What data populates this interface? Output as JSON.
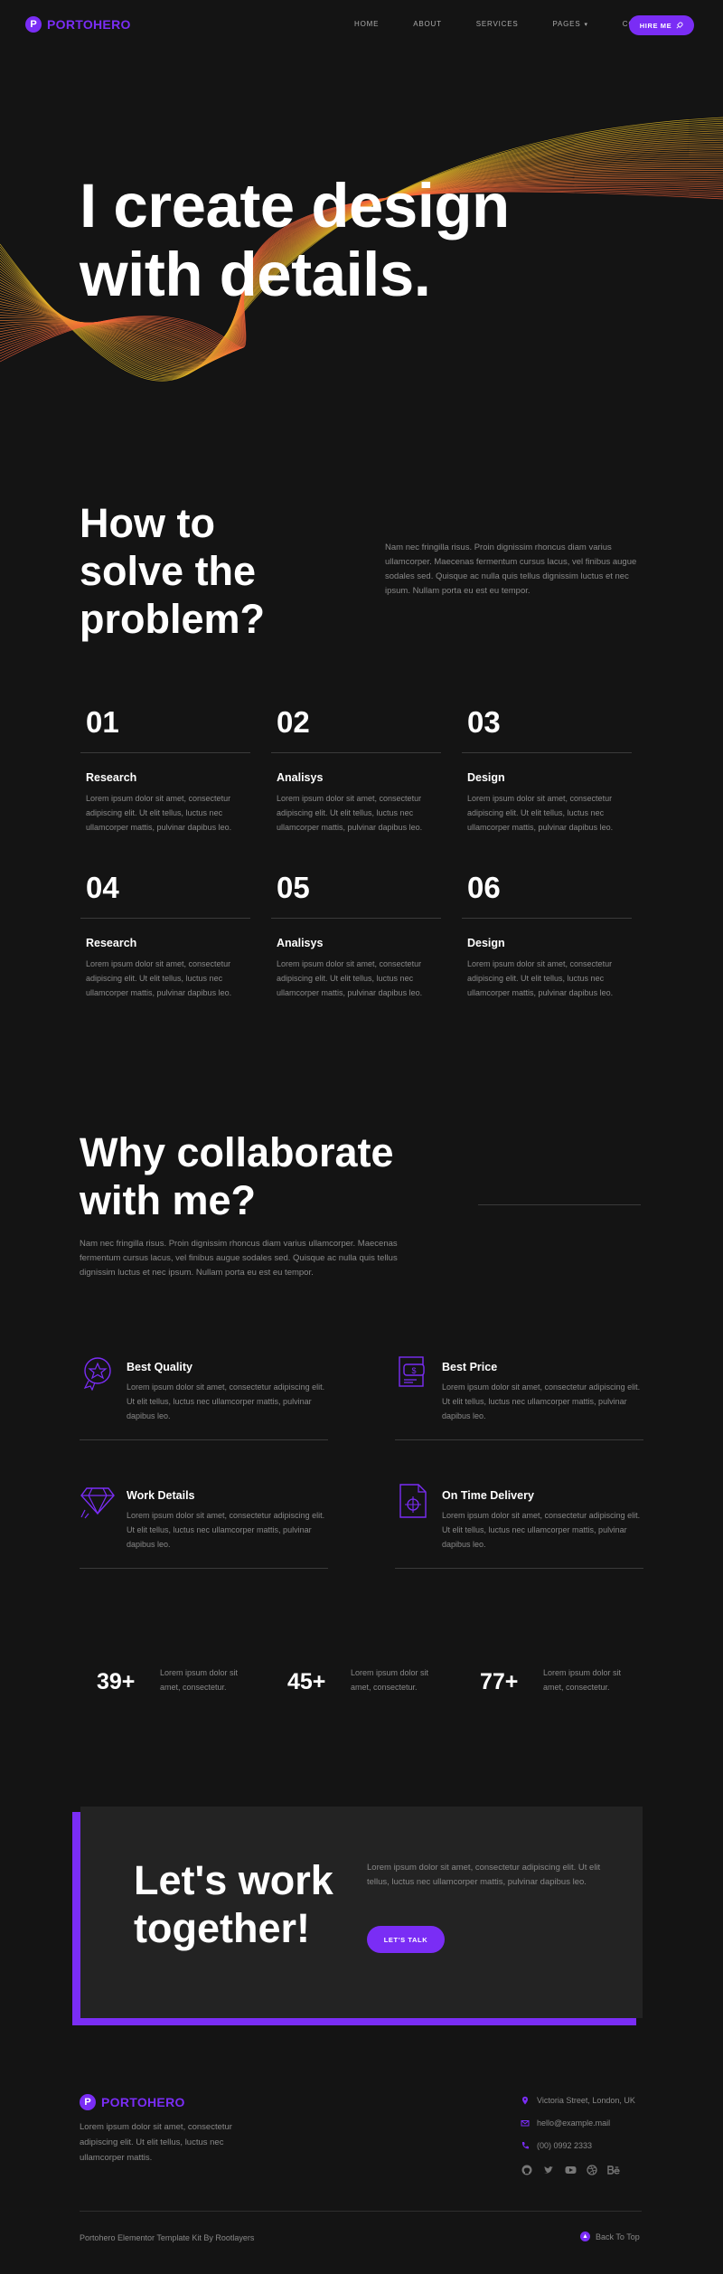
{
  "brand": {
    "logo_letter": "P",
    "name": "PORTOHERO",
    "accent": "#7a2df5"
  },
  "nav": {
    "items": [
      "HOME",
      "ABOUT",
      "SERVICES",
      "PAGES",
      "CONTACT"
    ],
    "pages_chevron": "chevron-down-icon",
    "hire_label": "HIRE ME",
    "hire_icon": "rocket-icon"
  },
  "hero": {
    "line1": "I create design",
    "line2": "with details."
  },
  "problem": {
    "title_lines": [
      "How to",
      "solve the",
      "problem?"
    ],
    "description": "Nam nec fringilla risus. Proin dignissim rhoncus diam varius ullamcorper. Maecenas fermentum cursus lacus, vel finibus augue sodales sed. Quisque ac nulla quis tellus dignissim luctus et nec ipsum. Nullam porta eu est eu tempor.",
    "steps": [
      {
        "num": "01",
        "title": "Research",
        "text": "Lorem ipsum dolor sit amet, consectetur adipiscing elit. Ut elit tellus, luctus nec ullamcorper mattis, pulvinar dapibus leo."
      },
      {
        "num": "02",
        "title": "Analisys",
        "text": "Lorem ipsum dolor sit amet, consectetur adipiscing elit. Ut elit tellus, luctus nec ullamcorper mattis, pulvinar dapibus leo."
      },
      {
        "num": "03",
        "title": "Design",
        "text": "Lorem ipsum dolor sit amet, consectetur adipiscing elit. Ut elit tellus, luctus nec ullamcorper mattis, pulvinar dapibus leo."
      },
      {
        "num": "04",
        "title": "Research",
        "text": "Lorem ipsum dolor sit amet, consectetur adipiscing elit. Ut elit tellus, luctus nec ullamcorper mattis, pulvinar dapibus leo."
      },
      {
        "num": "05",
        "title": "Analisys",
        "text": "Lorem ipsum dolor sit amet, consectetur adipiscing elit. Ut elit tellus, luctus nec ullamcorper mattis, pulvinar dapibus leo."
      },
      {
        "num": "06",
        "title": "Design",
        "text": "Lorem ipsum dolor sit amet, consectetur adipiscing elit. Ut elit tellus, luctus nec ullamcorper mattis, pulvinar dapibus leo."
      }
    ]
  },
  "collab": {
    "title_lines": [
      "Why collaborate",
      "with me?"
    ],
    "description": "Nam nec fringilla risus. Proin dignissim rhoncus diam varius ullamcorper. Maecenas fermentum cursus lacus, vel finibus augue sodales sed. Quisque ac nulla quis tellus dignissim luctus et nec ipsum. Nullam porta eu est eu tempor.",
    "features": [
      {
        "icon": "quality-badge-icon",
        "title": "Best Quality",
        "text": "Lorem ipsum dolor sit amet, consectetur adipiscing elit. Ut elit tellus, luctus nec ullamcorper mattis, pulvinar dapibus leo."
      },
      {
        "icon": "price-tag-icon",
        "title": "Best Price",
        "text": "Lorem ipsum dolor sit amet, consectetur adipiscing elit. Ut elit tellus, luctus nec ullamcorper mattis, pulvinar dapibus leo."
      },
      {
        "icon": "diamond-icon",
        "title": "Work Details",
        "text": "Lorem ipsum dolor sit amet, consectetur adipiscing elit. Ut elit tellus, luctus nec ullamcorper mattis, pulvinar dapibus leo."
      },
      {
        "icon": "delivery-document-icon",
        "title": "On Time Delivery",
        "text": "Lorem ipsum dolor sit amet, consectetur adipiscing elit. Ut elit tellus, luctus nec ullamcorper mattis, pulvinar dapibus leo."
      }
    ]
  },
  "stats": [
    {
      "num": "39+",
      "text": "Lorem ipsum dolor sit amet, consectetur."
    },
    {
      "num": "45+",
      "text": "Lorem ipsum dolor sit amet, consectetur."
    },
    {
      "num": "77+",
      "text": "Lorem ipsum dolor sit amet, consectetur."
    }
  ],
  "cta": {
    "title_lines": [
      "Let's work",
      "together!"
    ],
    "text": "Lorem ipsum dolor sit amet, consectetur adipiscing elit. Ut elit tellus, luctus nec ullamcorper mattis, pulvinar dapibus leo.",
    "button": "LET'S TALK"
  },
  "footer": {
    "description": "Lorem ipsum dolor sit amet, consectetur adipiscing elit. Ut elit tellus, luctus nec ullamcorper mattis.",
    "address": "Victoria Street, London, UK",
    "email": "hello@example.mail",
    "phone": "(00) 0992 2333",
    "socials": [
      "github-icon",
      "twitter-icon",
      "youtube-icon",
      "dribbble-icon",
      "behance-icon"
    ],
    "copyright": "Portohero Elementor Template Kit By Rootlayers",
    "back_to_top": "Back To Top"
  }
}
